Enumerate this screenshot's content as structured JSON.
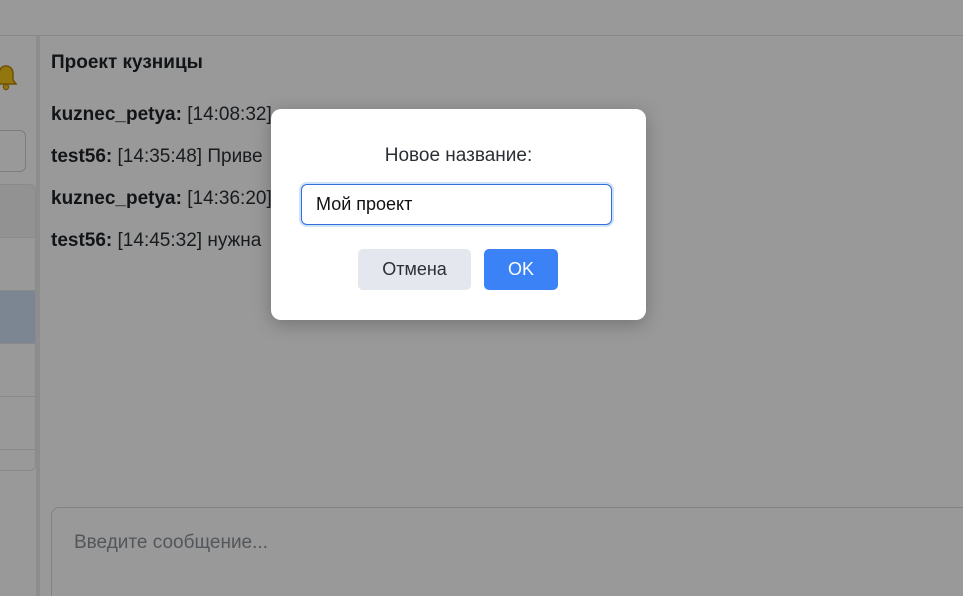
{
  "chat": {
    "title": "Проект кузницы",
    "messages": [
      {
        "author": "kuznec_petya:",
        "time": "[14:08:32]",
        "text": ""
      },
      {
        "author": "test56:",
        "time": "[14:35:48]",
        "text": "Приве"
      },
      {
        "author": "kuznec_petya:",
        "time": "[14:36:20]",
        "text": ""
      },
      {
        "author": "test56:",
        "time": "[14:45:32]",
        "text": "нужна"
      }
    ],
    "composer_placeholder": "Введите сообщение..."
  },
  "sidebar": {
    "bell_icon": "bell-icon"
  },
  "modal": {
    "title": "Новое название:",
    "input_value": "Мой проект",
    "cancel_label": "Отмена",
    "ok_label": "OK"
  },
  "colors": {
    "primary": "#3b82f6",
    "cancel_bg": "#e4e8ee",
    "active_row": "#cfe0f5"
  }
}
